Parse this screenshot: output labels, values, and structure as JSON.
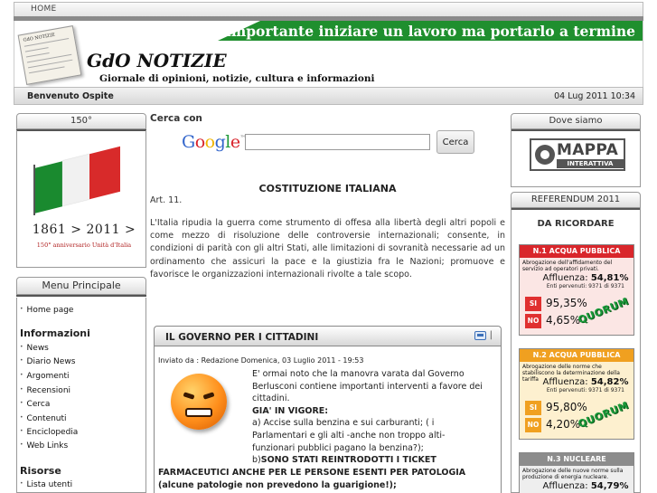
{
  "nav": {
    "home": "HOME"
  },
  "header": {
    "slogan": "Non è importante iniziare un lavoro ma portarlo a termine",
    "logo_text": "GdO NOTIZIE",
    "title": "GdO NOTIZIE",
    "subtitle": "Giornale di opinioni, notizie, cultura e informazioni"
  },
  "welcome": {
    "greeting": "Benvenuto Ospite",
    "datetime": "04 Lug 2011 10:34"
  },
  "left": {
    "box150_title": "150°",
    "years": "1861 > 2011 >",
    "anniversary": "150° anniversario Unità d'Italia",
    "menu_title": "Menu Principale",
    "menu": {
      "home": "Home page",
      "info_head": "Informazioni",
      "info": [
        "News",
        "Diario News",
        "Argomenti",
        "Recensioni",
        "Cerca",
        "Contenuti",
        "Enciclopedia",
        "Web Links"
      ],
      "risorse_head": "Risorse",
      "risorse": [
        "Lista utenti"
      ]
    }
  },
  "search": {
    "label": "Cerca con",
    "brand": "Google",
    "tm": "™",
    "button": "Cerca",
    "value": ""
  },
  "constitution": {
    "title": "COSTITUZIONE ITALIANA",
    "article": "Art. 11.",
    "text": "L'Italia ripudia la guerra come strumento di offesa alla libertà degli altri popoli e come mezzo di risoluzione delle controversie internazionali; consente, in condizioni di parità con gli altri Stati, alle limitazioni di sovranità necessarie ad un ordinamento che assicuri la pace e la giustizia fra le Nazioni; promuove e favorisce le organizzazioni internazionali rivolte a tale scopo."
  },
  "news": {
    "title": "IL GOVERNO PER I CITTADINI",
    "meta": "Inviato da : Redazione  Domenica, 03 Luglio 2011 - 19:53",
    "intro": "E' ormai noto che la manovra varata dal Governo Berlusconi contiene importanti interventi a favore dei cittadini.",
    "gia": "GIA' IN VIGORE:",
    "point_a": "a) Accise sulla benzina e sui carburanti; ( i Parlamentari e gli alti -anche non troppo alti- funzionari pubblici pagano la benzina?);",
    "point_b_lead": "b)",
    "point_b": "SONO STATI REINTRODOTTI I TICKET",
    "point_b_cont": "FARMACEUTICI ANCHE PER LE PERSONE ESENTI PER PATOLOGIA (alcune patologie non prevedono la guarigione!);"
  },
  "right": {
    "dove_title": "Dove siamo",
    "mappa_main": "MAPPA",
    "mappa_sub": "INTERATTIVA",
    "ref_title": "REFERENDUM 2011",
    "ref_head": "DA RICORDARE",
    "cards": [
      {
        "title": "N.1 ACQUA PUBBLICA",
        "desc": "Abrogazione dell'affidamento del servizio ad operatori privati.",
        "affluenza_label": "Affluenza:",
        "affluenza": "54,81%",
        "enti": "Enti pervenuti: 9371 di 9371",
        "si_label": "SI",
        "si": "95,35%",
        "no_label": "NO",
        "no": "4,65%",
        "quorum": "QUORUM"
      },
      {
        "title": "N.2 ACQUA PUBBLICA",
        "desc": "Abrogazione delle norme che stabiliscono la determinazione della tariffa",
        "affluenza_label": "Affluenza:",
        "affluenza": "54,82%",
        "enti": "Enti pervenuti: 9371 di 9371",
        "si_label": "SI",
        "si": "95,80%",
        "no_label": "NO",
        "no": "4,20%",
        "quorum": "QUORUM"
      },
      {
        "title": "N.3 NUCLEARE",
        "desc": "Abrogazione delle nuove norme sulla produzione di energia nucleare.",
        "affluenza_label": "Affluenza:",
        "affluenza": "54,79%"
      }
    ]
  },
  "colors": {
    "green": "#1f8f2e",
    "red_card": "#d9262b",
    "yellow_card": "#f0a020",
    "gray_card": "#8c8c8c"
  }
}
